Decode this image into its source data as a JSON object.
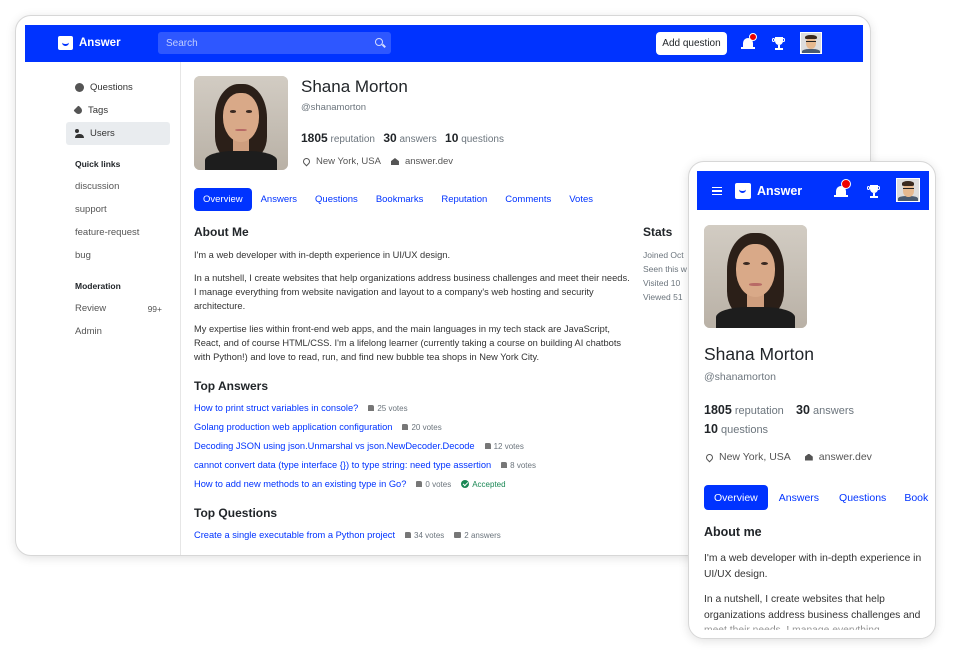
{
  "app": {
    "logo_text": "Answer"
  },
  "header": {
    "search_placeholder": "Search",
    "add_question_label": "Add question",
    "notification_icon": "bell-icon",
    "achievement_icon": "trophy-icon",
    "accent_color": "#0033ff"
  },
  "sidebar": {
    "items": [
      {
        "label": "Questions",
        "icon": "question-circle-icon"
      },
      {
        "label": "Tags",
        "icon": "tag-icon"
      },
      {
        "label": "Users",
        "icon": "people-icon",
        "active": true
      }
    ],
    "quick_links_title": "Quick links",
    "quick_links": [
      "discussion",
      "support",
      "feature-request",
      "bug"
    ],
    "moderation_title": "Moderation",
    "moderation": [
      {
        "label": "Review",
        "badge": "99+"
      },
      {
        "label": "Admin"
      }
    ]
  },
  "profile": {
    "name": "Shana Morton",
    "handle": "@shanamorton",
    "reputation": "1805",
    "reputation_label": "reputation",
    "answers": "30",
    "answers_label": "answers",
    "questions": "10",
    "questions_label": "questions",
    "location": "New York, USA",
    "website": "answer.dev"
  },
  "tabs": [
    "Overview",
    "Answers",
    "Questions",
    "Bookmarks",
    "Reputation",
    "Comments",
    "Votes"
  ],
  "about": {
    "title": "About Me",
    "p1": "I'm a web developer with in-depth experience in UI/UX design.",
    "p2": "In a nutshell, I create websites that help organizations address business challenges and meet their needs. I manage everything from website navigation and layout to a company's web hosting and security architecture.",
    "p3": "My expertise lies within front-end web apps, and the main languages in my tech stack are JavaScript, React, and of course HTML/CSS. I'm a lifelong learner (currently taking a course on building AI chatbots with Python!) and love to read, run, and find new bubble tea shops in New York City."
  },
  "top_answers": {
    "title": "Top Answers",
    "items": [
      {
        "title": "How to print struct variables in console?",
        "votes": "25 votes"
      },
      {
        "title": "Golang production web application configuration",
        "votes": "20 votes"
      },
      {
        "title": "Decoding JSON using json.Unmarshal vs json.NewDecoder.Decode",
        "votes": "12 votes"
      },
      {
        "title": "cannot convert data (type interface {}) to type string: need type assertion",
        "votes": "8 votes"
      },
      {
        "title": "How to add new methods to an existing type in Go?",
        "votes": "0 votes",
        "status": "Accepted"
      }
    ]
  },
  "top_questions": {
    "title": "Top Questions",
    "items": [
      {
        "title": "Create a single executable from a Python project",
        "votes": "34 votes",
        "answers": "2 answers"
      }
    ]
  },
  "stats": {
    "title": "Stats",
    "lines": [
      "Joined Oct",
      "Seen this w",
      "Visited 10",
      "Viewed 51"
    ]
  },
  "mobile": {
    "tabs": [
      "Overview",
      "Answers",
      "Questions",
      "Book"
    ],
    "about_title": "About me",
    "p1": "I'm a web developer with in-depth experience in UI/UX design.",
    "p2": "In a nutshell, I create websites that help organizations address business challenges and meet their needs. I manage everything"
  }
}
